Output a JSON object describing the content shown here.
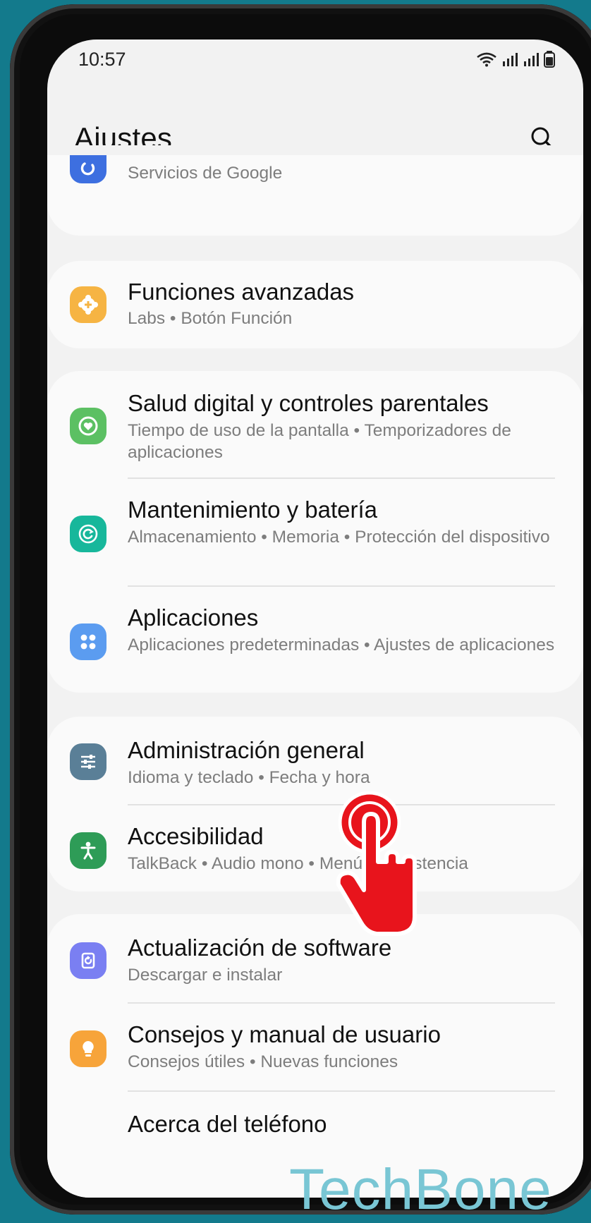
{
  "status_bar": {
    "time": "10:57"
  },
  "header": {
    "title": "Ajustes",
    "search_icon": "search-icon"
  },
  "items": [
    {
      "id": "google",
      "title": "",
      "subtitle": "Servicios de Google",
      "icon": "google-icon",
      "color": "#3d6fe0"
    },
    {
      "id": "advanced",
      "title": "Funciones avanzadas",
      "subtitle": "Labs  •  Botón Función",
      "icon": "plus-gear-icon",
      "color": "#f6b443"
    },
    {
      "id": "wellbeing",
      "title": "Salud digital y controles parentales",
      "subtitle": "Tiempo de uso de la pantalla  •  Temporizadores de aplicaciones",
      "icon": "heart-circle-icon",
      "color": "#5cc063"
    },
    {
      "id": "maintenance",
      "title": "Mantenimiento y batería",
      "subtitle": "Almacenamiento  •  Memoria  •  Protección del dispositivo",
      "icon": "refresh-icon",
      "color": "#17b79b"
    },
    {
      "id": "apps",
      "title": "Aplicaciones",
      "subtitle": "Aplicaciones predeterminadas  •  Ajustes de aplicaciones",
      "icon": "apps-grid-icon",
      "color": "#5b9cf0"
    },
    {
      "id": "general",
      "title": "Administración general",
      "subtitle": "Idioma y teclado  •  Fecha y hora",
      "icon": "sliders-icon",
      "color": "#5a7f97"
    },
    {
      "id": "accessibility",
      "title": "Accesibilidad",
      "subtitle": "TalkBack  •  Audio mono  •  Menú de asistencia",
      "icon": "accessibility-person-icon",
      "color": "#2e9c57"
    },
    {
      "id": "update",
      "title": "Actualización de software",
      "subtitle": "Descargar e instalar",
      "icon": "software-update-icon",
      "color": "#7a7ff2"
    },
    {
      "id": "tips",
      "title": "Consejos y manual de usuario",
      "subtitle": "Consejos útiles  •  Nuevas funciones",
      "icon": "lightbulb-icon",
      "color": "#f7a43a"
    },
    {
      "id": "about",
      "title": "Acerca del teléfono",
      "subtitle": "",
      "icon": "",
      "color": ""
    }
  ],
  "overlay": {
    "hand_icon": "tap-hand-icon",
    "hand_color": "#e8141c",
    "watermark": "TechBone"
  }
}
